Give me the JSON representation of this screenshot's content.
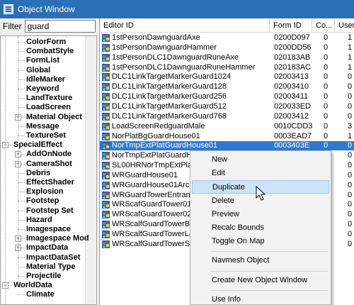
{
  "window": {
    "title": "Object Window"
  },
  "filter": {
    "label": "Filter",
    "value": "guard"
  },
  "tree": [
    {
      "label": "ColorForm",
      "level": 2
    },
    {
      "label": "CombatStyle",
      "level": 2
    },
    {
      "label": "FormList",
      "level": 2
    },
    {
      "label": "Global",
      "level": 2
    },
    {
      "label": "IdleMarker",
      "level": 2
    },
    {
      "label": "Keyword",
      "level": 2
    },
    {
      "label": "LandTexture",
      "level": 2
    },
    {
      "label": "LoadScreen",
      "level": 2
    },
    {
      "label": "Material Object",
      "level": 2,
      "expander": "+"
    },
    {
      "label": "Message",
      "level": 2
    },
    {
      "label": "TextureSet",
      "level": 2
    },
    {
      "label": "SpecialEffect",
      "level": 1,
      "expander": "−"
    },
    {
      "label": "AddOnNode",
      "level": 2,
      "expander": "+"
    },
    {
      "label": "CameraShot",
      "level": 2,
      "expander": "+"
    },
    {
      "label": "Debris",
      "level": 2
    },
    {
      "label": "EffectShader",
      "level": 2
    },
    {
      "label": "Explosion",
      "level": 2
    },
    {
      "label": "Footstep",
      "level": 2
    },
    {
      "label": "Footstep Set",
      "level": 2
    },
    {
      "label": "Hazard",
      "level": 2
    },
    {
      "label": "Imagespace",
      "level": 2
    },
    {
      "label": "Imagespace Mod",
      "level": 2,
      "expander": "+"
    },
    {
      "label": "ImpactData",
      "level": 2,
      "expander": "+"
    },
    {
      "label": "ImpactDataSet",
      "level": 2
    },
    {
      "label": "Material Type",
      "level": 2
    },
    {
      "label": "Projectile",
      "level": 2
    },
    {
      "label": "WorldData",
      "level": 1,
      "expander": "−"
    },
    {
      "label": "Climate",
      "level": 2
    }
  ],
  "list": {
    "columns": [
      "Editor ID",
      "Form ID",
      "Co...",
      "User"
    ],
    "rows": [
      {
        "editor_id": "1stPersonDawnguardAxe",
        "form_id": "0200D097",
        "count": "0",
        "users": "1"
      },
      {
        "editor_id": "1stPersonDawnguardHammer",
        "form_id": "0200DD56",
        "count": "0",
        "users": "1"
      },
      {
        "editor_id": "1stPersonDLC1DawnguardRuneAxe",
        "form_id": "020183AB",
        "count": "0",
        "users": "1"
      },
      {
        "editor_id": "1stPersonDLC1DawnguardRuneHammer",
        "form_id": "020183AC",
        "count": "0",
        "users": "1"
      },
      {
        "editor_id": "DLC1LinkTargetMarkerGuard1024",
        "form_id": "02003413",
        "count": "0",
        "users": "0"
      },
      {
        "editor_id": "DLC1LinkTargetMarkerGuard128",
        "form_id": "02003410",
        "count": "0",
        "users": "0"
      },
      {
        "editor_id": "DLC1LinkTargetMarkerGuard256",
        "form_id": "02003411",
        "count": "0",
        "users": "0"
      },
      {
        "editor_id": "DLC1LinkTargetMarkerGuard512",
        "form_id": "020033ED",
        "count": "0",
        "users": "0"
      },
      {
        "editor_id": "DLC1LinkTargetMarkerGuard768",
        "form_id": "02003412",
        "count": "0",
        "users": "0"
      },
      {
        "editor_id": "LoadScreenRedguardMale",
        "form_id": "0010CDD3",
        "count": "0",
        "users": "3"
      },
      {
        "editor_id": "NorPlatBgGuardHouse01",
        "form_id": "0003EAD7",
        "count": "0",
        "users": "1"
      },
      {
        "editor_id": "NorTmpExtPlatGuardHouse01",
        "form_id": "0003403E",
        "count": "0",
        "users": "0"
      },
      {
        "editor_id": "NorTmpExtPlatGuardHouse01",
        "form_id": "",
        "count": "",
        "users": "0"
      },
      {
        "editor_id": "SL00HRNorTmpExtPlatGu",
        "form_id": "",
        "count": "",
        "users": "0"
      },
      {
        "editor_id": "WRGuardHouse01",
        "form_id": "",
        "count": "",
        "users": "0"
      },
      {
        "editor_id": "WRGuardHouse01Arch01",
        "form_id": "",
        "count": "",
        "users": "0"
      },
      {
        "editor_id": "WRGuardTowerEntrance0",
        "form_id": "",
        "count": "",
        "users": "0"
      },
      {
        "editor_id": "WRScafGuardTower01",
        "form_id": "",
        "count": "",
        "users": "0"
      },
      {
        "editor_id": "WRScafGuardTower02",
        "form_id": "",
        "count": "",
        "users": "0"
      },
      {
        "editor_id": "WRScalfGuardTowerBase0",
        "form_id": "",
        "count": "",
        "users": "0"
      },
      {
        "editor_id": "WRScalfGuardTowerLarge",
        "form_id": "",
        "count": "",
        "users": "0"
      },
      {
        "editor_id": "WRScalfGuardTowerSpike",
        "form_id": "",
        "count": "",
        "users": "0"
      }
    ]
  },
  "context_menu": {
    "items": [
      {
        "label": "New"
      },
      {
        "label": "Edit"
      },
      {
        "label": "Duplicate",
        "highlighted": true
      },
      {
        "label": "Delete"
      },
      {
        "label": "Preview"
      },
      {
        "label": "Recalc Bounds"
      },
      {
        "label": "Toggle On Map"
      },
      {
        "separator": true
      },
      {
        "label": "Navmesh Object"
      },
      {
        "separator": true
      },
      {
        "label": "Create New Object Window"
      },
      {
        "separator": true
      },
      {
        "label": "Use Info"
      }
    ]
  },
  "colors": {
    "title_bar": "#2b6fb5",
    "selection": "#3079d0",
    "menu_highlight": "#cce4f7"
  },
  "icons": {
    "record": "object-record-icon",
    "cursor": "mouse-pointer-icon"
  }
}
